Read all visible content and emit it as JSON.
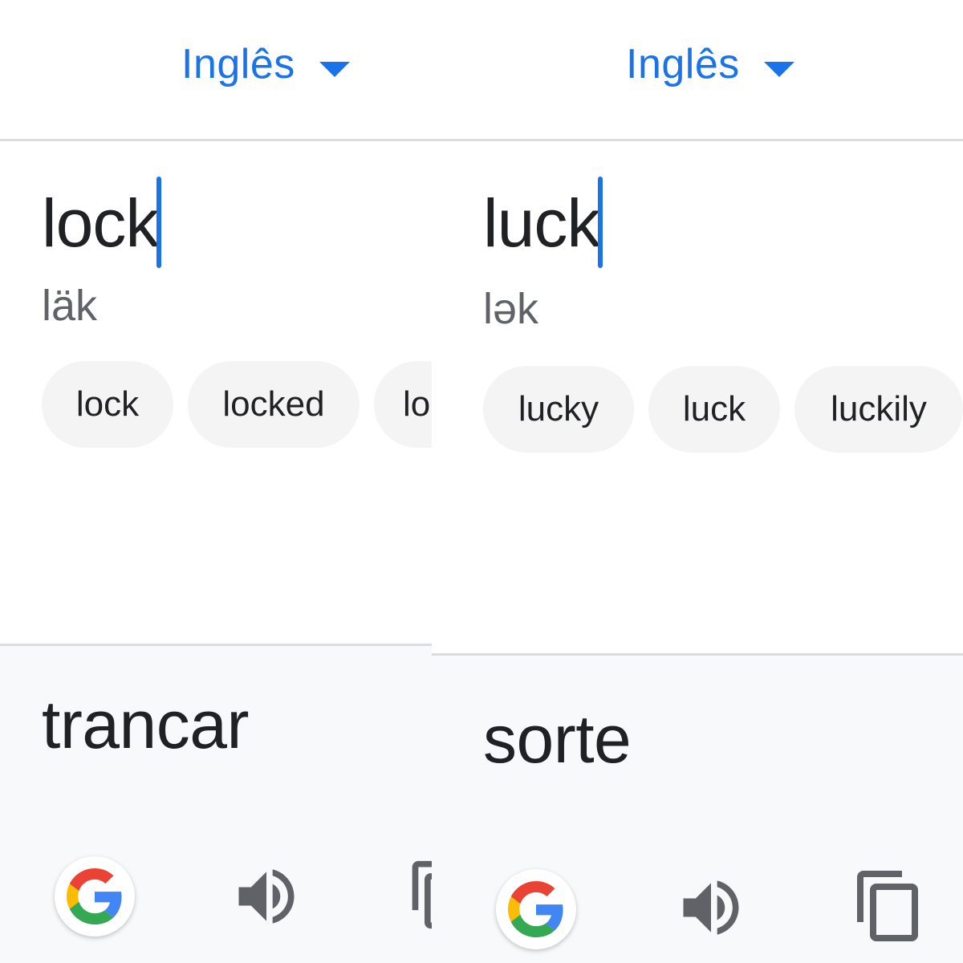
{
  "left_panel": {
    "language_selector": {
      "label": "Inglês"
    },
    "source_text": "lock",
    "phonetic": "läk",
    "suggestions": [
      "lock",
      "locked",
      "lo"
    ],
    "translation": "trancar"
  },
  "right_panel": {
    "language_selector": {
      "label": "Inglês"
    },
    "source_text": "luck",
    "phonetic": "lək",
    "suggestions": [
      "lucky",
      "luck",
      "luckily"
    ],
    "translation": "sorte"
  },
  "colors": {
    "accent": "#1a73e8",
    "icon_gray": "#5f6368",
    "divider": "#dadce0",
    "chip_background": "#f4f4f5",
    "result_background": "#f8f9fa"
  },
  "icons": [
    "chevron-down-icon",
    "google-icon",
    "speaker-icon",
    "copy-icon"
  ]
}
